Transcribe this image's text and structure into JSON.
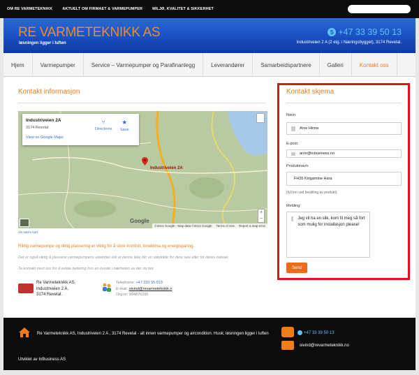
{
  "topbar": {
    "links": [
      "OM RE VARMETEKNIKK",
      "AKTUELT OM FIRMAET & VARMEPUMPER",
      "MILJØ, KVALITET & SIKKERHET"
    ]
  },
  "header": {
    "brand": "RE VARMETEKNIKK AS",
    "slogan": "løsningen ligger i luften",
    "phone": "+47 33 39 50 13",
    "address": "Industriveien 2 A (2 etg. i Næringsbygget), 3174 Revetal."
  },
  "nav": {
    "items": [
      "Hjem",
      "Varmepumper",
      "Service – Varmepumper og Parafinanlegg",
      "Leverandører",
      "Samarbeidspartnere",
      "Galleri",
      "Kontakt oss"
    ]
  },
  "contact_info": {
    "title": "Kontakt informasjon",
    "map": {
      "place": "Industriveien 2A",
      "city": "3174 Revetal",
      "view_link": "View on Google Maps",
      "directions": "Directions",
      "save": "Save",
      "pin_label": "Industriveien 2A",
      "google": "Google",
      "attribution": [
        "©2014 Google - Map data ©2014 Google",
        "Terms of Use",
        "Report a map error"
      ]
    },
    "larger_map": "Vis større kart",
    "p1": "Riktig varmepumpe og riktig plassering er viktig for å sikre komfort, inneklima og energisparing.",
    "p2": "Det er også viktig å plassere varmepumpens uteenhet slik at denne ikke blir en støykilde for dere selv eller for deres naboer.",
    "p3": "Ta kontakt med oss for å avtale befaring hos en kunde i nærheten av der du bor.",
    "company": [
      "Re Varmeteknikk AS,",
      "Industriveien 2 A,",
      "3174 Revetal."
    ],
    "telephone_label": "Telephone:",
    "telephone": "+47 333 95 013",
    "email_label": "E-mail:",
    "email": "oivind@revarmeteknikk.n",
    "orgnr_label": "Org-nr:",
    "orgnr": "994876295"
  },
  "form": {
    "title": "Kontakt skjema",
    "name_label": "Navn:",
    "name_value": "Arve Hinna",
    "email_label": "E-post:",
    "email_value": "arve@inbusiness.no",
    "product_label": "Produktnavn:",
    "product_value": "FH35 Kirigamine Hara",
    "product_hint": "(fyll inn ved bestilling av produkt)",
    "message_label": "Melding:",
    "message_value": "Jeg vil ha en slik, kom til meg så fort som mulig for installasjon please!",
    "send": "Send"
  },
  "footer": {
    "text": "Re Varmeteknikk AS, Industriveien 2 A , 3174 Revetal - alt innen varmepumper og aircondition. Husk; løsningen ligger i luften",
    "phone": "+47 33 39 50 13",
    "email": "oivind@revarmeteknikk.no",
    "credit": "Utviklet av InBusiness AS"
  },
  "colors": {
    "accent": "#f07c1a",
    "header_blue": "#1a4fc0",
    "highlight_red": "#e0151b",
    "link_blue": "#3a6ed8"
  }
}
